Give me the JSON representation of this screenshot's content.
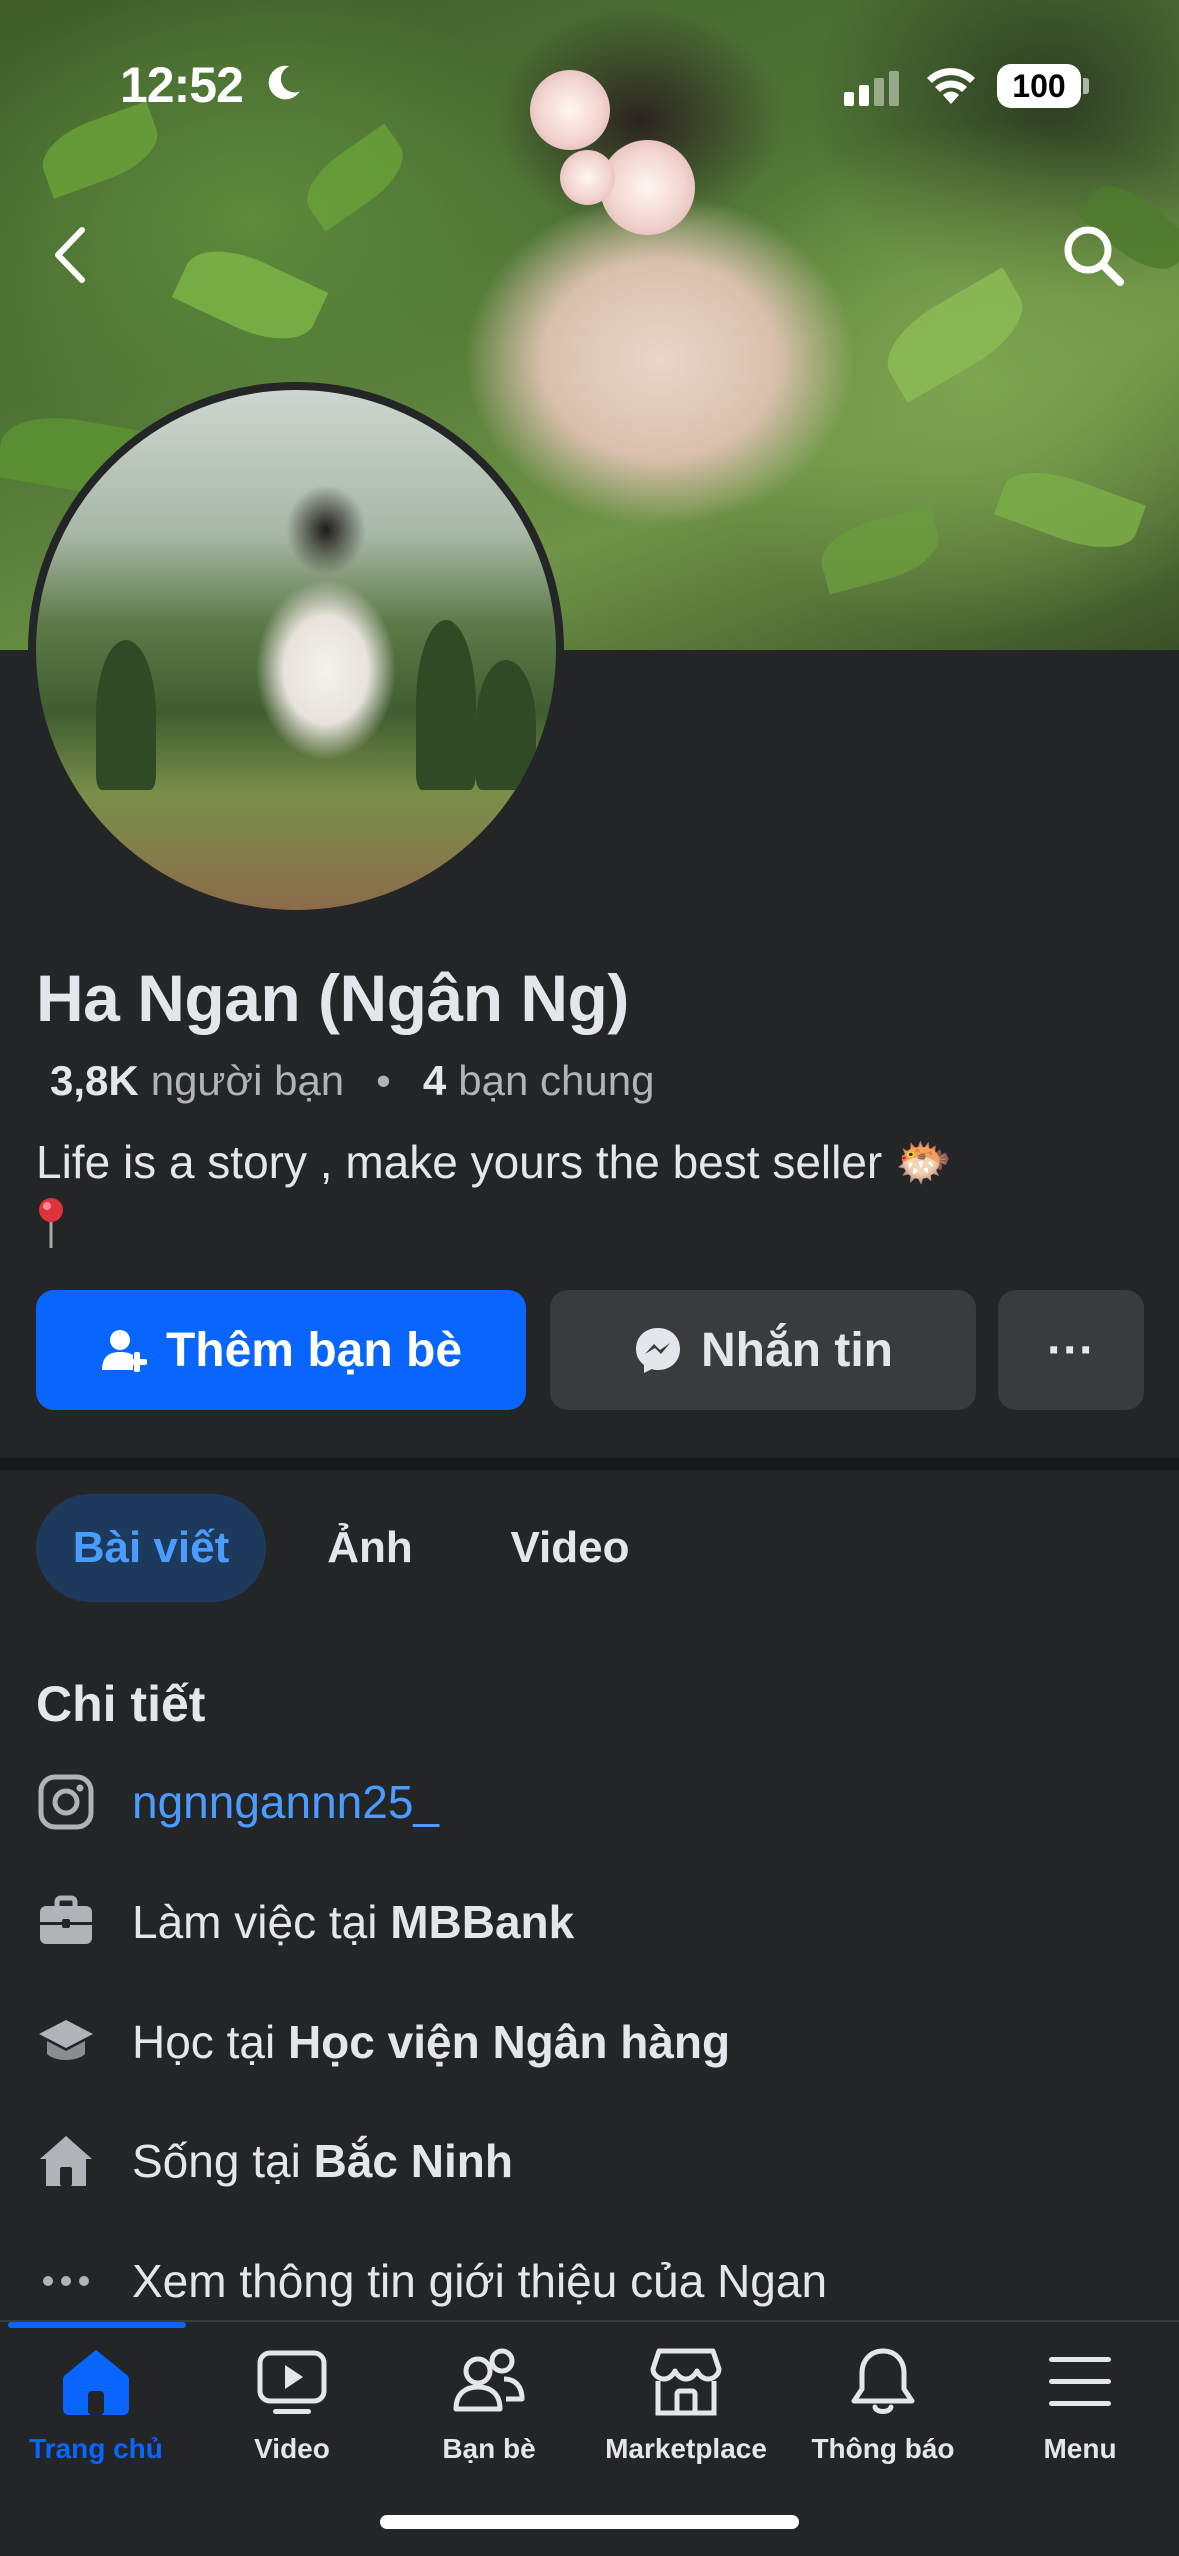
{
  "status_bar": {
    "time": "12:52",
    "battery": "100"
  },
  "cover": {
    "description_icons": [
      "back-icon",
      "search-icon"
    ]
  },
  "profile": {
    "name": "Ha Ngan (Ngân Ng)",
    "friends_count": "3,8K",
    "friends_label": "người bạn",
    "mutual_count": "4",
    "mutual_label": "bạn chung",
    "bio": "Life is a story , make yours the best seller 🐡"
  },
  "actions": {
    "add_friend": "Thêm bạn bè",
    "message": "Nhắn tin",
    "more": "···"
  },
  "tabs": [
    {
      "label": "Bài viết",
      "active": true
    },
    {
      "label": "Ảnh",
      "active": false
    },
    {
      "label": "Video",
      "active": false
    }
  ],
  "details": {
    "title": "Chi tiết",
    "instagram": "ngnngannn25_",
    "work_prefix": "Làm việc tại ",
    "work_place": "MBBank",
    "study_prefix": "Học tại ",
    "study_place": "Học viện Ngân hàng",
    "live_prefix": "Sống tại ",
    "live_place": "Bắc Ninh",
    "see_more": "Xem thông tin giới thiệu của Ngan"
  },
  "bottom_nav": [
    {
      "label": "Trang chủ",
      "icon": "home-icon",
      "active": true
    },
    {
      "label": "Video",
      "icon": "video-icon",
      "active": false
    },
    {
      "label": "Bạn bè",
      "icon": "friends-icon",
      "active": false
    },
    {
      "label": "Marketplace",
      "icon": "marketplace-icon",
      "active": false
    },
    {
      "label": "Thông báo",
      "icon": "bell-icon",
      "active": false
    },
    {
      "label": "Menu",
      "icon": "menu-icon",
      "active": false
    }
  ],
  "colors": {
    "background": "#242526",
    "primary_blue": "#0866ff",
    "link_blue": "#4b9cff",
    "secondary_button": "#3a3b3c",
    "secondary_text": "#b0b3b8"
  }
}
